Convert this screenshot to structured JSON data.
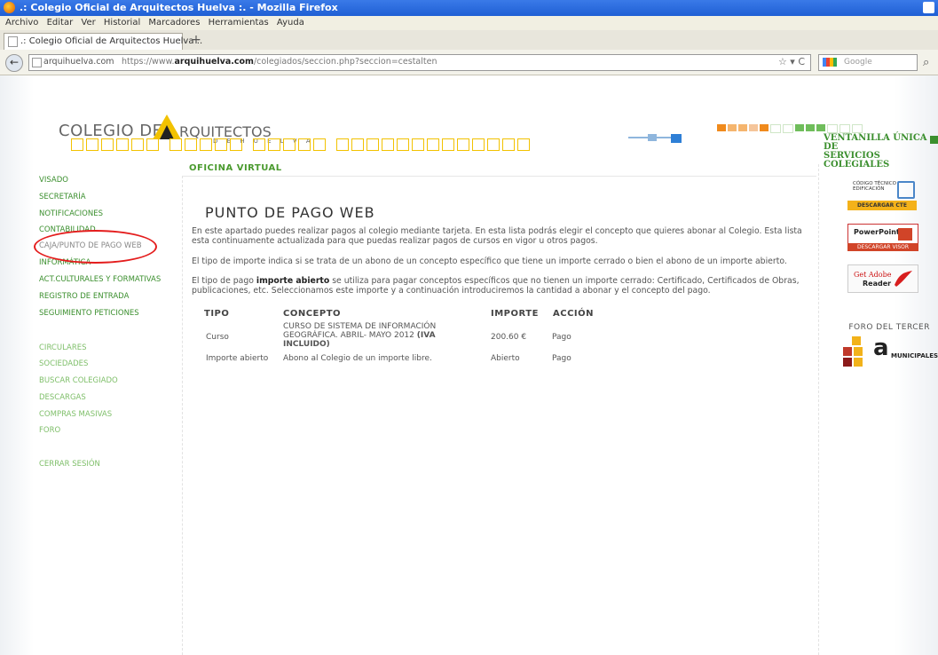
{
  "window": {
    "title": ".: Colegio Oficial de Arquitectos Huelva :. - Mozilla Firefox"
  },
  "menubar": [
    "Archivo",
    "Editar",
    "Ver",
    "Historial",
    "Marcadores",
    "Herramientas",
    "Ayuda"
  ],
  "tab": {
    "label": ".: Colegio Oficial de Arquitectos Huelva :.",
    "new_tab": "+"
  },
  "nav": {
    "back": "←",
    "url_domain": "arquihuelva.com",
    "url_prefix": "https://www.",
    "url_host": "arquihuelva.com",
    "url_path": "/colegiados/seccion.php?seccion=cestalten",
    "url_controls": "☆ ▾ C",
    "search_placeholder": "Google",
    "search_icon": "⌕"
  },
  "header": {
    "logo_part1": "COLEGIO DE",
    "logo_part2": "RQUITECTOS",
    "logo_part3": "D E   H U E L V A",
    "ventanilla_line1": "VENTANILLA ÚNICA DE",
    "ventanilla_line2": "SERVICIOS COLEGIALES",
    "square_colors": [
      "#f08a1c",
      "#f5b56e",
      "#f5b56e",
      "#f5c59a",
      "#f08a1c",
      "#ffffff",
      "#ffffff",
      "#6fbd5b",
      "#6fbd5b",
      "#6fbd5b",
      "#ffffff",
      "#ffffff",
      "#ffffff"
    ]
  },
  "section_title": "OFICINA VIRTUAL",
  "left_menu": [
    {
      "label": "VISADO",
      "style": "normal"
    },
    {
      "label": "SECRETARÍA",
      "style": "normal"
    },
    {
      "label": "NOTIFICACIONES",
      "style": "normal"
    },
    {
      "label": "CONTABILIDAD",
      "style": "normal"
    },
    {
      "label": "CAJA/PUNTO DE PAGO WEB",
      "style": "light"
    },
    {
      "label": "INFORMÁTICA",
      "style": "normal"
    },
    {
      "label": "ACT.CULTURALES Y FORMATIVAS",
      "style": "normal"
    },
    {
      "label": "REGISTRO DE ENTRADA",
      "style": "normal"
    },
    {
      "label": "SEGUIMIENTO PETICIONES",
      "style": "normal"
    },
    {
      "label": "CIRCULARES",
      "style": "light"
    },
    {
      "label": "SOCIEDADES",
      "style": "light"
    },
    {
      "label": "BUSCAR COLEGIADO",
      "style": "light"
    },
    {
      "label": "DESCARGAS",
      "style": "light"
    },
    {
      "label": "COMPRAS MASIVAS",
      "style": "light"
    },
    {
      "label": "FORO",
      "style": "light"
    },
    {
      "label": "CERRAR SESIÓN",
      "style": "light"
    }
  ],
  "main": {
    "heading": "PUNTO DE PAGO WEB",
    "para1": "En este apartado puedes realizar pagos al colegio mediante tarjeta. En esta lista podrás elegir el concepto que quieres abonar al Colegio. Esta lista esta continuamente actualizada para que puedas realizar pagos de cursos en vigor u otros pagos.",
    "para2": "El tipo de importe indica si se trata de un abono de un concepto específico que tiene un importe cerrado o bien el abono de un importe abierto.",
    "para3_a": "El tipo de pago ",
    "para3_b": "importe abierto",
    "para3_c": " se utiliza para pagar conceptos específicos que no tienen un importe cerrado: Certificado, Certificados de Obras, publicaciones, etc. Seleccionamos este importe y a continuación introduciremos la cantidad a abonar y el concepto del pago."
  },
  "table": {
    "headers": {
      "tipo": "TIPO",
      "concepto": "CONCEPTO",
      "importe": "IMPORTE",
      "accion": "ACCIÓN"
    },
    "rows": [
      {
        "tipo": "Curso",
        "concepto_l1": "CURSO DE SISTEMA DE INFORMACIÓN",
        "concepto_l2": "GEOGRÁFICA. ABRIL- MAYO 2012",
        "concepto_bold": "(IVA",
        "concepto_l3": "INCLUIDO)",
        "importe": "200.60 €",
        "accion": "Pago"
      },
      {
        "tipo": "Importe abierto",
        "concepto_l1": "Abono al Colegio de un importe libre.",
        "importe": "Abierto",
        "accion": "Pago"
      }
    ]
  },
  "right_sidebar": {
    "cte_line1": "CÓDIGO TÉCNICO",
    "cte_line2": "EDIFICACIÓN",
    "cte_button": "DESCARGAR CTE",
    "ppt_label": "PowerPoint",
    "ppt_button": "DESCARGAR VISOR",
    "adobe_get": "Get Adobe",
    "adobe_reader": "Reader",
    "foro_label": "FORO DEL TERCER",
    "foro_logo_letter": "a",
    "foro_logo_text": "MUNICIPALES"
  }
}
